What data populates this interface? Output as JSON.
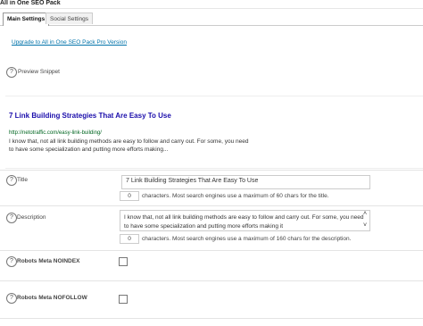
{
  "panel": {
    "title": "All in One SEO Pack"
  },
  "tabs": [
    {
      "label": "Main Settings",
      "active": true
    },
    {
      "label": "Social Settings",
      "active": false
    }
  ],
  "upgrade_link": "Upgrade to All in One SEO Pack Pro Version",
  "preview": {
    "label": "Preview Snippet",
    "title": "7 Link Building Strategies That Are Easy To Use",
    "url": "http://netotraffic.com/easy-link-building/",
    "description": "I know that, not all link building methods are easy to follow and carry out. For some, you need to have some specialization and putting more efforts making..."
  },
  "title_field": {
    "label": "Title",
    "value": "7 Link Building Strategies That Are Easy To Use",
    "counter": "0",
    "note": "characters. Most search engines use a maximum of 60 chars for the title."
  },
  "description_field": {
    "label": "Description",
    "value": "I know that, not all link building methods are easy to follow and carry out. For some, you need to have some specialization and putting more efforts making it",
    "counter": "0",
    "note": "characters. Most search engines use a maximum of 160 chars for the description."
  },
  "robots_noindex": {
    "label": "Robots Meta NOINDEX",
    "checked": false
  },
  "robots_nofollow": {
    "label": "Robots Meta NOFOLLOW",
    "checked": false
  },
  "icons": {
    "help": "question-mark-icon",
    "help_glyph": "?",
    "scroll_up": "˄",
    "scroll_down": "˅"
  },
  "colors": {
    "link": "#0073aa",
    "snippet_title": "#1a0dab",
    "snippet_url": "#006621"
  }
}
